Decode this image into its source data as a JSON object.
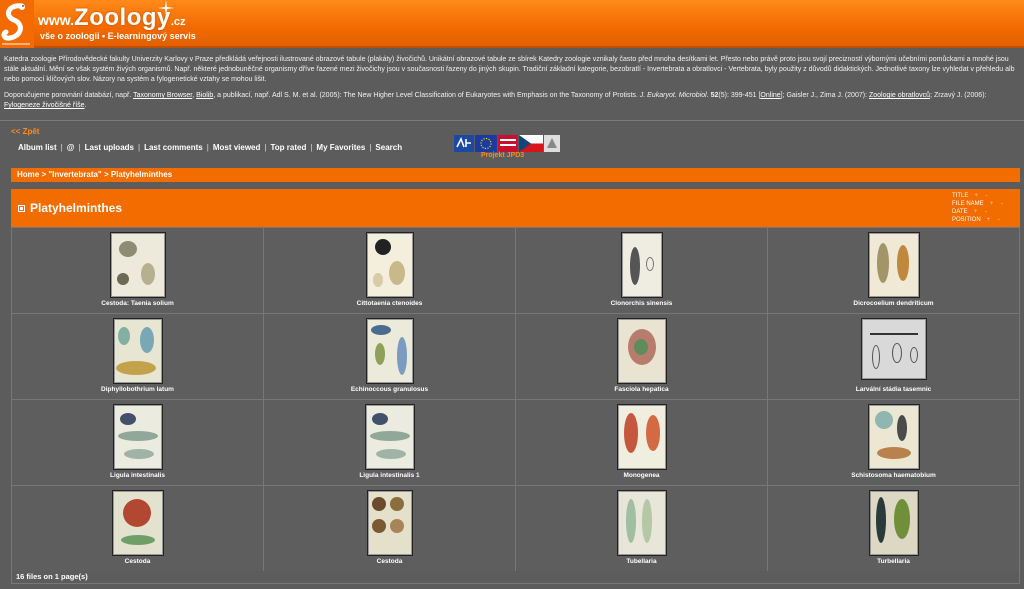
{
  "header": {
    "www": "www.",
    "brand": "Zoology",
    "tld": ".cz",
    "tagline": "vše o zoologii • E-learningový servis"
  },
  "intro": {
    "p1": "Katedra zoologie Přírodovědecké fakulty Univerzity Karlovy v Praze předkládá veřejnosti ilustrované obrazové tabule (plakáty) živočichů. Unikátní obrazové tabule ze sbírek Katedry zoologie vznikaly často před mnoha desítkami let. Přesto nebo právě proto jsou svojí precizností výbornými učebními pomůckami a mnohé jsou stále aktuální. Mění se však systém živých organismů. Např. některé jednobuněčné organismy dříve řazené mezi živočichy jsou v současnosti řazeny do jiných skupin. Tradiční základní kategorie, bezobratlí - Invertebrata a obratlovci - Vertebrata, byly použity z důvodů didaktických. Jednotlivé taxony lze vyhledat v přehledu alb nebo pomocí klíčových slov. Názory na systém a fylogenetické vztahy se mohou lišit.",
    "p2_start": "Doporučujeme porovnání databází, např. ",
    "link_taxonomy": "Taxonomy Browser",
    "comma1": ", ",
    "link_biolib": "Biolib",
    "p2_mid": ", a publikací, např. Adl S. M. et al. (2005): The New Higher Level Classification of Eukaryotes with Emphasis on the Taxonomy of Protists. ",
    "journal": "J. Eukaryot. Microbiol.",
    "volume": " 52",
    "pages": "(5): 399-451 [",
    "link_online": "Online",
    "p2_end": "]; Gaisler J., Zima J. (2007): ",
    "link_zoologie": "Zoologie obratlovců",
    "p2_end2": "; Zrzavý J. (2006): ",
    "link_fylogeneze": "Fylogeneze živočišné říše",
    "dot": "."
  },
  "back_link": "<< Zpět",
  "nav": {
    "items": [
      "Album list",
      "@",
      "Last uploads",
      "Last comments",
      "Most viewed",
      "Top rated",
      "My Favorites",
      "Search"
    ],
    "project": "Projekt JPD3"
  },
  "breadcrumb": "Home > \"Invertebrata\" > Platyhelminthes",
  "album": {
    "title": "Platyhelminthes",
    "sort": [
      {
        "label": "TITLE"
      },
      {
        "label": "FILE NAME"
      },
      {
        "label": "DATE"
      },
      {
        "label": "POSITION"
      }
    ],
    "plus": "+",
    "minus": "-"
  },
  "thumbnails": [
    {
      "caption": "Cestoda: Taenia solium"
    },
    {
      "caption": "Cittotaenia ctenoides"
    },
    {
      "caption": "Clonorchis sinensis"
    },
    {
      "caption": "Dicrocoelium dendriticum"
    },
    {
      "caption": "Diphyllobothrium latum"
    },
    {
      "caption": "Echinoccous granulosus"
    },
    {
      "caption": "Fasciola hepatica"
    },
    {
      "caption": "Larvální stádia tasemnic"
    },
    {
      "caption": "Ligula intestinalis"
    },
    {
      "caption": "Ligula intestinalis 1"
    },
    {
      "caption": "Monogenea"
    },
    {
      "caption": "Schistosoma haematobium"
    },
    {
      "caption": "Cestoda"
    },
    {
      "caption": "Cestoda"
    },
    {
      "caption": "Tubellaria"
    },
    {
      "caption": "Turbellaria"
    }
  ],
  "footer": "16 files on 1 page(s)",
  "colors": {
    "accent": "#f26c00",
    "background": "#5c5c5c",
    "link_orange": "#ff8a1a"
  }
}
